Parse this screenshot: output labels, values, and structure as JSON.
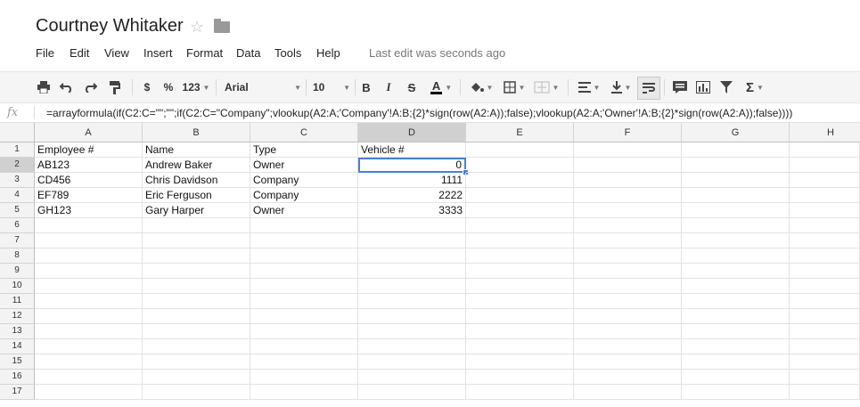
{
  "doc": {
    "title": "Courtney Whitaker",
    "star_icon": "star-outline-icon",
    "folder_icon": "folder-icon"
  },
  "menu": [
    "File",
    "Edit",
    "View",
    "Insert",
    "Format",
    "Data",
    "Tools",
    "Help"
  ],
  "last_edit": "Last edit was seconds ago",
  "toolbar": {
    "currency": "$",
    "percent": "%",
    "more_formats": "123",
    "font": "Arial",
    "font_size": "10",
    "bold": "B",
    "italic": "I",
    "strike": "S",
    "text_color_label": "A",
    "sum": "Σ"
  },
  "formula_bar": {
    "fx": "fx",
    "formula": "=arrayformula(if(C2:C=\"\";\"\";if(C2:C=\"Company\";vlookup(A2:A;'Company'!A:B;{2}*sign(row(A2:A));false);vlookup(A2:A;'Owner'!A:B;{2}*sign(row(A2:A));false))))"
  },
  "sheet": {
    "columns": [
      "A",
      "B",
      "C",
      "D",
      "E",
      "F",
      "G",
      "H"
    ],
    "selected_column": "D",
    "selected_row": "2",
    "row_numbers": [
      "1",
      "2",
      "3",
      "4",
      "5",
      "6",
      "7",
      "8",
      "9",
      "10",
      "11",
      "12",
      "13",
      "14",
      "15",
      "16",
      "17"
    ],
    "cells": {
      "r1": [
        "Employee #",
        "Name",
        "Type",
        "Vehicle #"
      ],
      "r2": [
        "AB123",
        "Andrew Baker",
        "Owner",
        "0"
      ],
      "r3": [
        "CD456",
        "Chris Davidson",
        "Company",
        "1111"
      ],
      "r4": [
        "EF789",
        "Eric Ferguson",
        "Company",
        "2222"
      ],
      "r5": [
        "GH123",
        "Gary Harper",
        "Owner",
        "3333"
      ]
    }
  },
  "colors": {
    "selection": "#4a7fd6",
    "header_bg": "#f3f3f3",
    "header_selected": "#d0d0d0"
  }
}
